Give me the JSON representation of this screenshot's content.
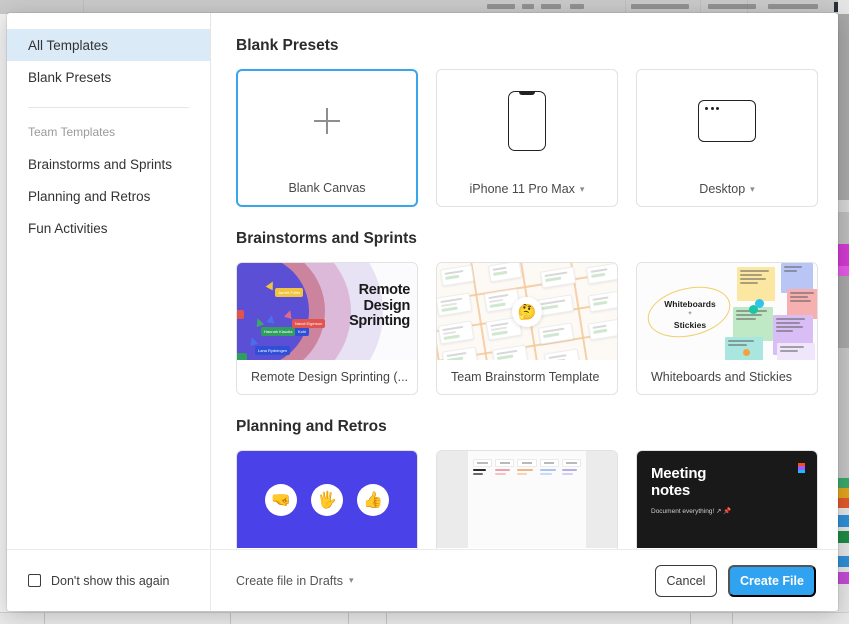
{
  "sidebar": {
    "items": [
      {
        "label": "All Templates",
        "active": true
      },
      {
        "label": "Blank Presets",
        "active": false
      }
    ],
    "group_label": "Team Templates",
    "team_items": [
      {
        "label": "Brainstorms and Sprints"
      },
      {
        "label": "Planning and Retros"
      },
      {
        "label": "Fun Activities"
      }
    ]
  },
  "sections": [
    {
      "title": "Blank Presets",
      "cards": [
        {
          "label": "Blank Canvas",
          "icon": "plus-icon",
          "selected": true,
          "dropdown": false
        },
        {
          "label": "iPhone 11 Pro Max",
          "icon": "phone-icon",
          "selected": false,
          "dropdown": true
        },
        {
          "label": "Desktop",
          "icon": "desktop-window-icon",
          "selected": false,
          "dropdown": true
        }
      ]
    },
    {
      "title": "Brainstorms and Sprints",
      "cards": [
        {
          "label": "Remote Design Sprinting (..."
        },
        {
          "label": "Team Brainstorm Template"
        },
        {
          "label": "Whiteboards and Stickies"
        }
      ]
    },
    {
      "title": "Planning and Retros",
      "cards": [
        {
          "label": ""
        },
        {
          "label": ""
        },
        {
          "label": ""
        }
      ]
    }
  ],
  "thumbnails": {
    "remote_design": {
      "title_lines": [
        "Remote",
        "Design",
        "Sprinting"
      ],
      "cursor_tags": [
        "Jarrett Fuller",
        "Hannah Klaudia",
        "Kohl",
        "Navot Eigerson",
        "Lana Rydningen"
      ]
    },
    "team_brainstorm": {
      "emoji": "🤔"
    },
    "whiteboards": {
      "line1": "Whiteboards",
      "plus": "+",
      "line2": "Stickies"
    },
    "hands": {
      "emojis": [
        "🤜",
        "🖐️",
        "👍"
      ]
    },
    "meeting_notes": {
      "title_lines": [
        "Meeting",
        "notes"
      ],
      "subtitle": "Document everything! ↗ 📌",
      "logo": "figma-logo-icon"
    },
    "calendar": {
      "headers": [
        "Decision",
        "Question",
        "Understand",
        "Prioritize",
        "Goals"
      ]
    }
  },
  "footer": {
    "checkbox_label": "Don't show this again",
    "checkbox_checked": false,
    "drafts_label": "Create file in Drafts",
    "cancel_label": "Cancel",
    "create_label": "Create File"
  },
  "colors": {
    "accent": "#2fa3ef",
    "sidebar_active": "#daeaf7",
    "selected_border": "#38a6e8",
    "hands_bg": "#4b41e8",
    "meeting_bg": "#191919"
  }
}
